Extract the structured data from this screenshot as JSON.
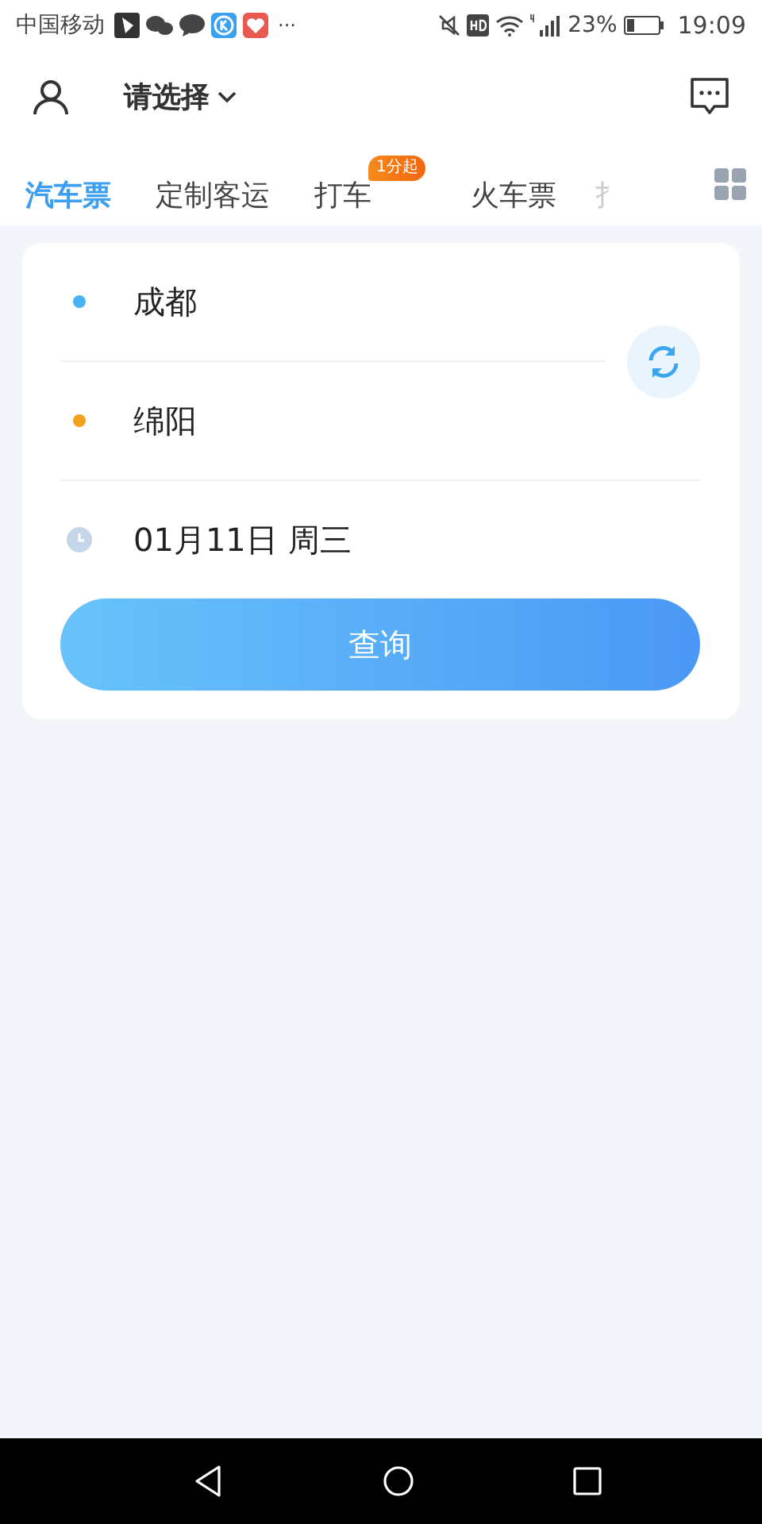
{
  "status_bar": {
    "carrier": "中国移动",
    "more": "···",
    "battery": "23%",
    "time": "19:09"
  },
  "header": {
    "city_select": "请选择"
  },
  "tabs": [
    {
      "label": "汽车票",
      "selected": true
    },
    {
      "label": "定制客运",
      "selected": false
    },
    {
      "label": "打车",
      "selected": false,
      "badge": "1分起"
    },
    {
      "label": "火车票",
      "selected": false
    },
    {
      "label": "扌",
      "selected": false
    }
  ],
  "form": {
    "stations": [
      {
        "name": "成都",
        "color": "#45b3f5"
      },
      {
        "name": "绵阳",
        "color": "#f5a01f"
      }
    ],
    "date": "01月11日  周三",
    "button": "查询"
  }
}
